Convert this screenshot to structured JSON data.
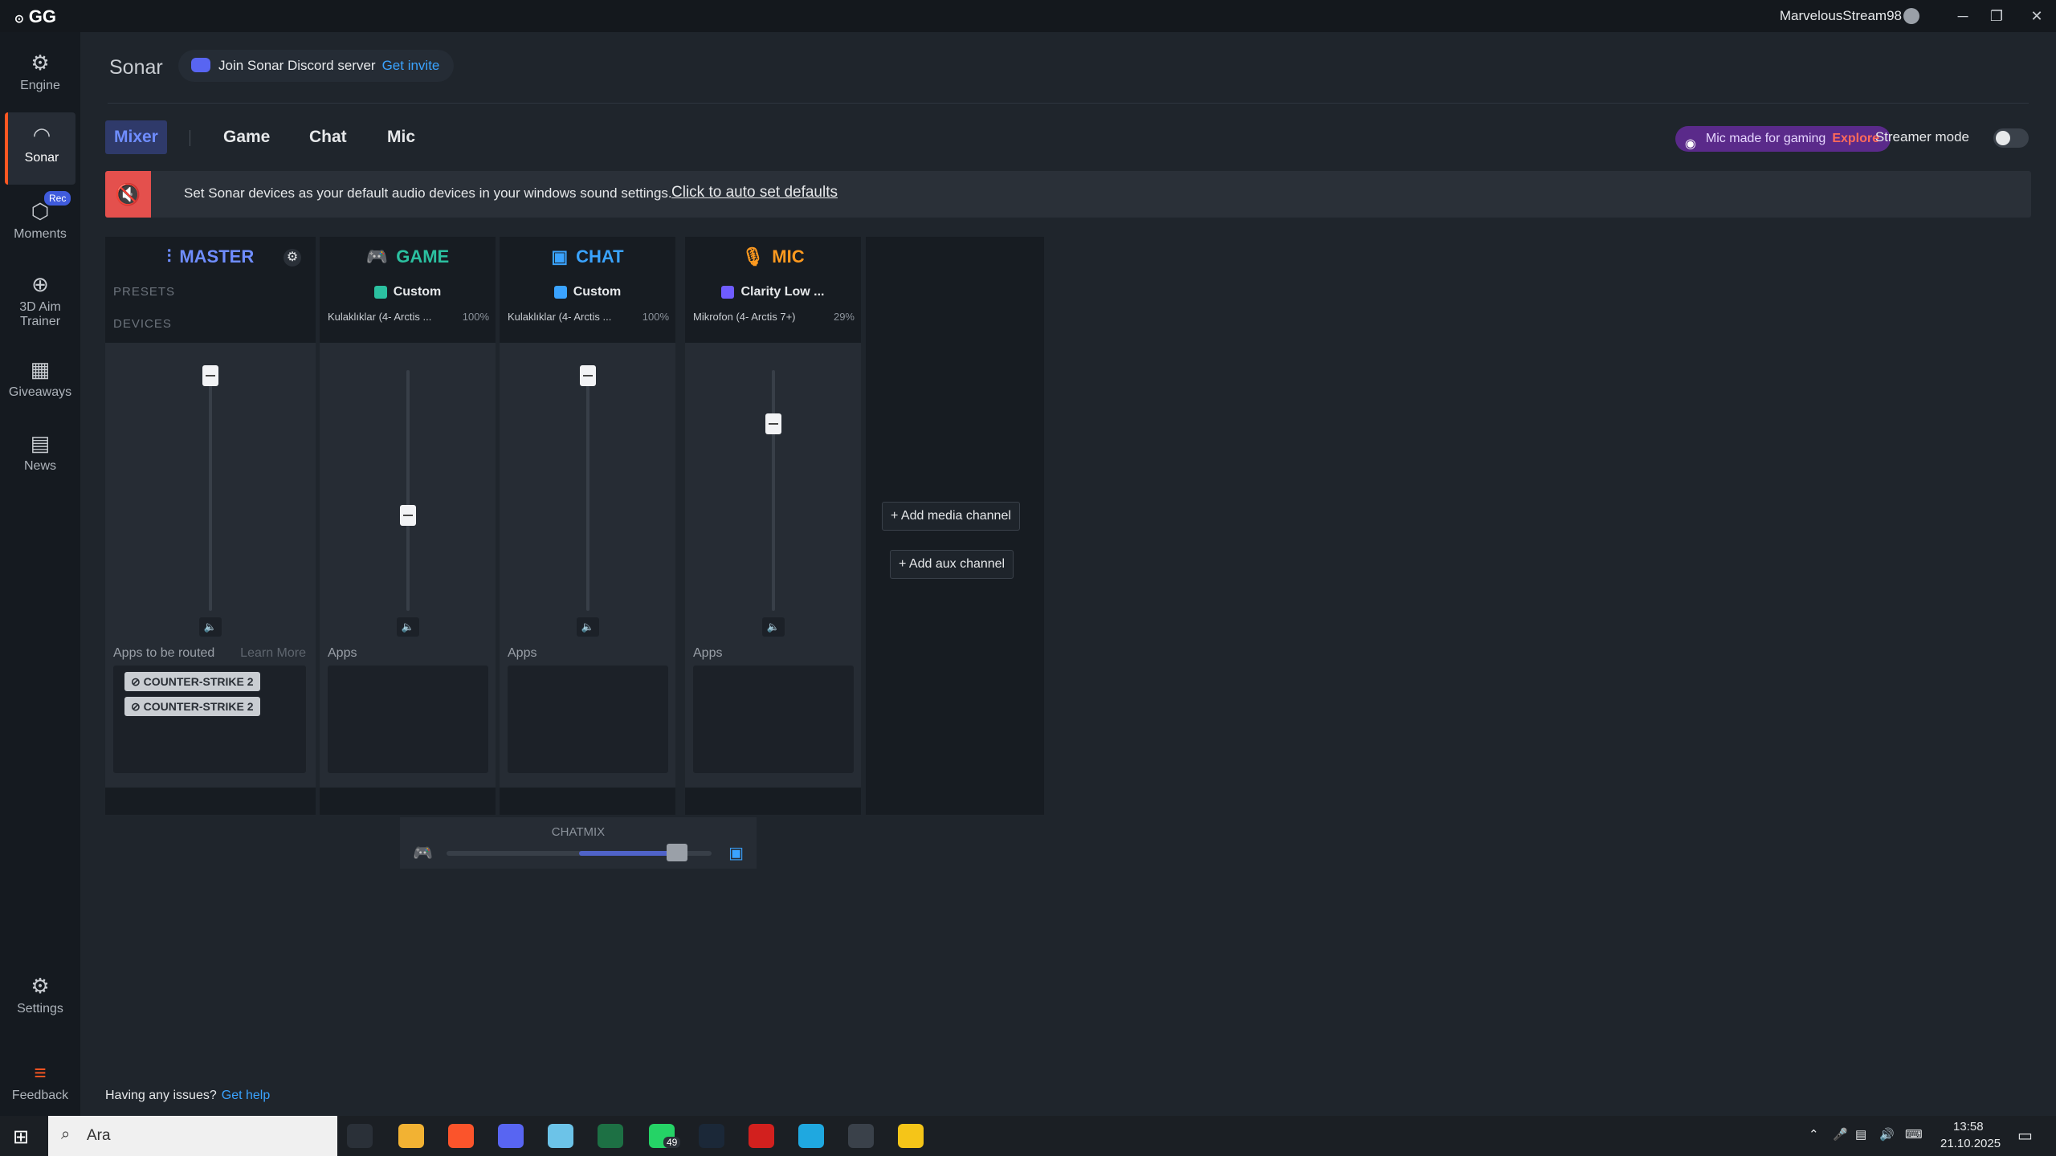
{
  "titlebar": {
    "logo": "GG",
    "username": "MarvelousStream98",
    "minimize": "─",
    "restore": "❐",
    "close": "✕"
  },
  "sidebar": {
    "items": [
      {
        "label": "Engine",
        "icon": "engine-icon",
        "glyph": "⚙"
      },
      {
        "label": "Sonar",
        "icon": "sonar-icon",
        "glyph": "◠"
      },
      {
        "label": "Moments",
        "icon": "moments-icon",
        "glyph": "⬡"
      },
      {
        "label": "3D Aim Trainer",
        "icon": "aim-trainer-icon",
        "glyph": "⊕"
      },
      {
        "label": "Giveaways",
        "icon": "gift-icon",
        "glyph": "▦"
      },
      {
        "label": "News",
        "icon": "news-icon",
        "glyph": "▤"
      },
      {
        "label": "Settings",
        "icon": "gear-icon",
        "glyph": "⚙"
      },
      {
        "label": "Feedback",
        "icon": "feedback-icon",
        "glyph": "≡"
      }
    ],
    "rec_badge": "Rec"
  },
  "header": {
    "title": "Sonar",
    "discord_text": "Join Sonar Discord server",
    "discord_link": "Get invite"
  },
  "tabs": {
    "mixer": "Mixer",
    "game": "Game",
    "chat": "Chat",
    "mic": "Mic"
  },
  "promo": {
    "text": "Mic made for gaming",
    "link": "Explore"
  },
  "streamer_mode": {
    "label": "Streamer mode",
    "enabled": false
  },
  "banner": {
    "text": "Set Sonar devices as your default audio devices in your windows sound settings.",
    "link": "Click to auto set defaults"
  },
  "channels": {
    "master": {
      "title": "MASTER",
      "presets_label": "PRESETS",
      "devices_label": "DEVICES",
      "apps_label": "Apps to be routed",
      "learn_more": "Learn More",
      "apps": [
        "COUNTER-STRIKE 2",
        "COUNTER-STRIKE 2"
      ],
      "level": 1.0
    },
    "game": {
      "title": "GAME",
      "preset": "Custom",
      "device": "Kulaklıklar (4- Arctis ...",
      "device_pct": "100%",
      "apps_label": "Apps",
      "level": 0.42
    },
    "chat": {
      "title": "CHAT",
      "preset": "Custom",
      "device": "Kulaklıklar (4- Arctis ...",
      "device_pct": "100%",
      "apps_label": "Apps",
      "level": 1.0
    },
    "mic": {
      "title": "MIC",
      "preset": "Clarity Low ...",
      "device": "Mikrofon (4- Arctis 7+)",
      "device_pct": "29%",
      "apps_label": "Apps",
      "level": 0.8
    }
  },
  "add_media": "+ Add media channel",
  "add_aux": "+ Add aux channel",
  "chatmix": {
    "label": "CHATMIX",
    "value": 0.87
  },
  "help": {
    "text": "Having any issues?",
    "link": "Get help"
  },
  "taskbar": {
    "search_placeholder": "Ara",
    "whatsapp_badge": "49",
    "time": "13:58",
    "date": "21.10.2025"
  },
  "colors": {
    "accent_master": "#6f8dff",
    "accent_game": "#2bc0a0",
    "accent_chat": "#3aa3ff",
    "accent_mic": "#ff9a1f",
    "sidebar_active": "#ff5722",
    "banner_icon_bg": "#e4504d"
  }
}
